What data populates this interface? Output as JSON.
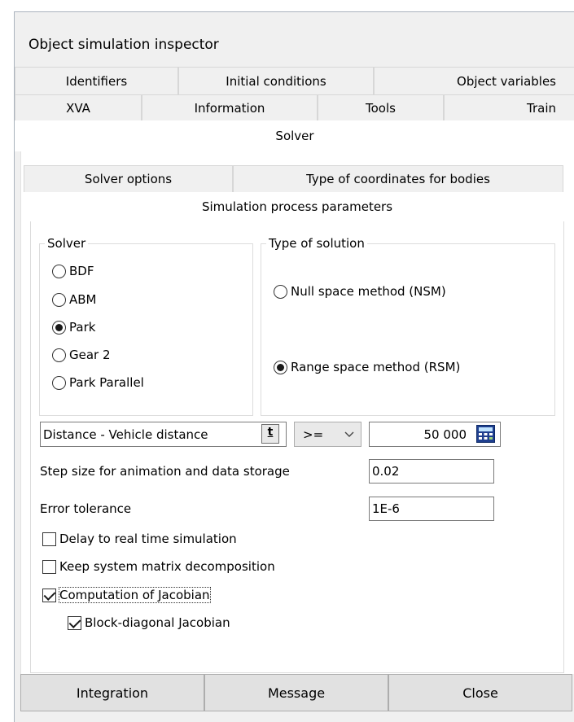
{
  "window": {
    "title": "Object simulation inspector"
  },
  "tabs": {
    "row1": [
      "Identifiers",
      "Initial conditions",
      "Object variables"
    ],
    "row2": [
      "XVA",
      "Information",
      "Tools",
      "Train"
    ],
    "active": "Solver"
  },
  "subtabs": {
    "row1": [
      "Solver options",
      "Type of coordinates for bodies"
    ],
    "active": "Simulation process parameters"
  },
  "solver_group": {
    "title": "Solver",
    "options": [
      "BDF",
      "ABM",
      "Park",
      "Gear 2",
      "Park Parallel"
    ],
    "selected": "Park"
  },
  "solution_group": {
    "title": "Type of solution",
    "options": [
      "Null space method (NSM)",
      "Range space method (RSM)"
    ],
    "selected": "Range space method (RSM)"
  },
  "stop_condition": {
    "variable": "Distance - Vehicle distance",
    "variable_button": "t",
    "operator": ">=",
    "value": "50 000"
  },
  "step_size": {
    "label": "Step size for animation and data storage",
    "value": "0.02"
  },
  "error_tolerance": {
    "label": "Error tolerance",
    "value": "1E-6"
  },
  "checkboxes": [
    {
      "label": "Delay to real time simulation",
      "checked": false
    },
    {
      "label": "Keep system matrix decomposition",
      "checked": false
    },
    {
      "label": "Computation of Jacobian",
      "checked": true
    },
    {
      "label": "Block-diagonal Jacobian",
      "checked": true
    }
  ],
  "buttons": {
    "integration": "Integration",
    "message": "Message",
    "close": "Close"
  },
  "icons": {
    "calculator": "calculator-icon",
    "dropdown": "chevron-down-icon"
  }
}
